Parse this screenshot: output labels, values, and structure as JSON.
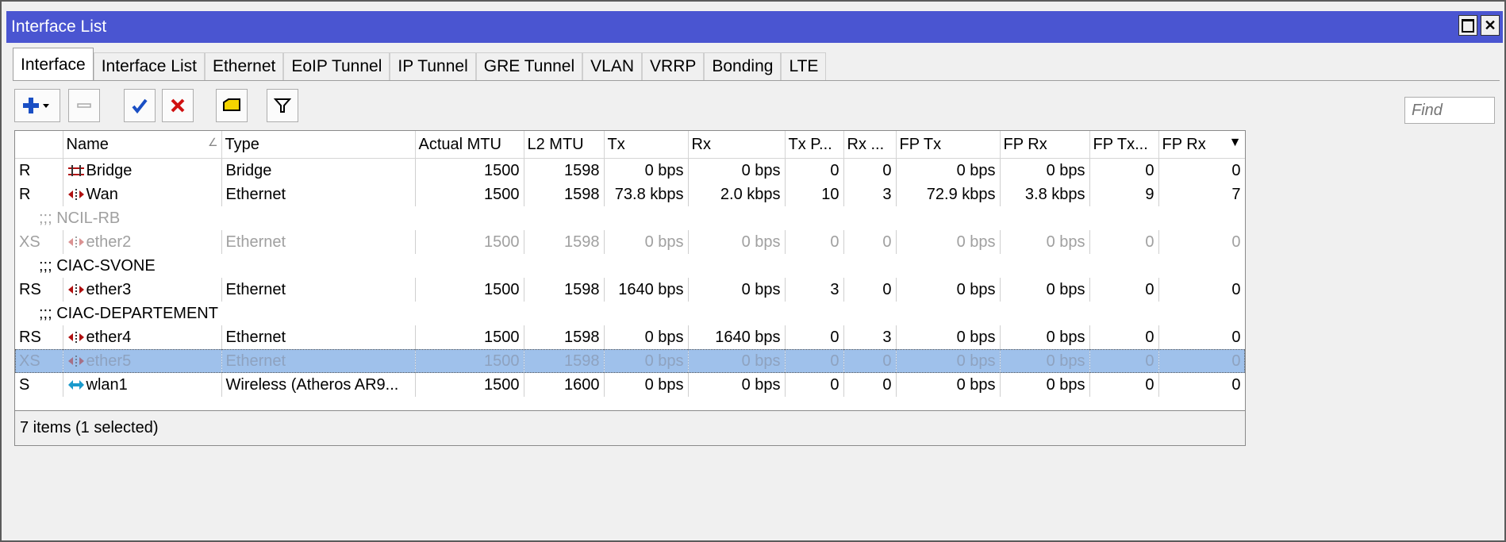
{
  "window": {
    "title": "Interface List"
  },
  "tabs": [
    "Interface",
    "Interface List",
    "Ethernet",
    "EoIP Tunnel",
    "IP Tunnel",
    "GRE Tunnel",
    "VLAN",
    "VRRP",
    "Bonding",
    "LTE"
  ],
  "search": {
    "placeholder": "Find"
  },
  "columns": [
    "",
    "Name",
    "Type",
    "Actual MTU",
    "L2 MTU",
    "Tx",
    "Rx",
    "Tx P...",
    "Rx ...",
    "FP Tx",
    "FP Rx",
    "FP Tx...",
    "FP Rx"
  ],
  "rows": [
    {
      "kind": "row",
      "flags": "R",
      "icon": "bridge-icon",
      "name": "Bridge",
      "type": "Bridge",
      "actual_mtu": "1500",
      "l2_mtu": "1598",
      "tx": "0 bps",
      "rx": "0 bps",
      "tx_p": "0",
      "rx_p": "0",
      "fp_tx": "0 bps",
      "fp_rx": "0 bps",
      "fp_tx_p": "0",
      "fp_rx_p": "0"
    },
    {
      "kind": "row",
      "flags": "R",
      "icon": "ethernet-icon",
      "name": "Wan",
      "type": "Ethernet",
      "actual_mtu": "1500",
      "l2_mtu": "1598",
      "tx": "73.8 kbps",
      "rx": "2.0 kbps",
      "tx_p": "10",
      "rx_p": "3",
      "fp_tx": "72.9 kbps",
      "fp_rx": "3.8 kbps",
      "fp_tx_p": "9",
      "fp_rx_p": "7"
    },
    {
      "kind": "comment",
      "text": ";;; NCIL-RB",
      "disabled": true
    },
    {
      "kind": "row",
      "flags": "XS",
      "disabled": true,
      "icon": "ethernet-icon",
      "name": "ether2",
      "type": "Ethernet",
      "actual_mtu": "1500",
      "l2_mtu": "1598",
      "tx": "0 bps",
      "rx": "0 bps",
      "tx_p": "0",
      "rx_p": "0",
      "fp_tx": "0 bps",
      "fp_rx": "0 bps",
      "fp_tx_p": "0",
      "fp_rx_p": "0"
    },
    {
      "kind": "comment",
      "text": ";;; CIAC-SVONE"
    },
    {
      "kind": "row",
      "flags": "RS",
      "icon": "ethernet-icon",
      "name": "ether3",
      "type": "Ethernet",
      "actual_mtu": "1500",
      "l2_mtu": "1598",
      "tx": "1640 bps",
      "rx": "0 bps",
      "tx_p": "3",
      "rx_p": "0",
      "fp_tx": "0 bps",
      "fp_rx": "0 bps",
      "fp_tx_p": "0",
      "fp_rx_p": "0"
    },
    {
      "kind": "comment",
      "text": ";;; CIAC-DEPARTEMENT"
    },
    {
      "kind": "row",
      "flags": "RS",
      "icon": "ethernet-icon",
      "name": "ether4",
      "type": "Ethernet",
      "actual_mtu": "1500",
      "l2_mtu": "1598",
      "tx": "0 bps",
      "rx": "1640 bps",
      "tx_p": "0",
      "rx_p": "3",
      "fp_tx": "0 bps",
      "fp_rx": "0 bps",
      "fp_tx_p": "0",
      "fp_rx_p": "0"
    },
    {
      "kind": "row",
      "flags": "XS",
      "disabled": true,
      "selected": true,
      "icon": "ethernet-icon",
      "name": "ether5",
      "type": "Ethernet",
      "actual_mtu": "1500",
      "l2_mtu": "1598",
      "tx": "0 bps",
      "rx": "0 bps",
      "tx_p": "0",
      "rx_p": "0",
      "fp_tx": "0 bps",
      "fp_rx": "0 bps",
      "fp_tx_p": "0",
      "fp_rx_p": "0"
    },
    {
      "kind": "row",
      "flags": "S",
      "icon": "wireless-icon",
      "name": "wlan1",
      "type": "Wireless (Atheros AR9...",
      "actual_mtu": "1500",
      "l2_mtu": "1600",
      "tx": "0 bps",
      "rx": "0 bps",
      "tx_p": "0",
      "rx_p": "0",
      "fp_tx": "0 bps",
      "fp_rx": "0 bps",
      "fp_tx_p": "0",
      "fp_rx_p": "0"
    }
  ],
  "status": {
    "text": "7 items (1 selected)"
  },
  "colors": {
    "titlebar": "#4a55d1",
    "selected_row": "#9fc1eb",
    "add": "#1a4fc4",
    "check": "#1a4fc4",
    "remove": "#d01010",
    "comment_icon": "#f5d400"
  }
}
